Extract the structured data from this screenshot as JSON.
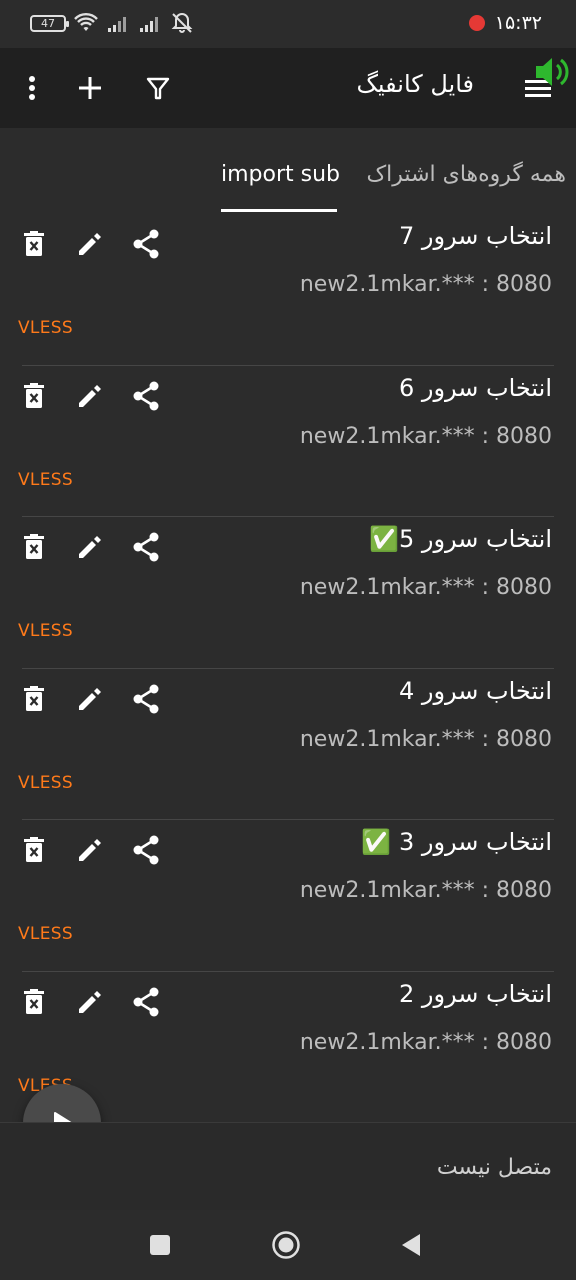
{
  "status_bar": {
    "battery": "47",
    "time": "۱۵:۳۲",
    "icons": [
      "battery-icon",
      "wifi-icon",
      "signal-icon",
      "signal-icon",
      "mute-icon",
      "recording-icon"
    ]
  },
  "toolbar": {
    "title": "فایل کانفیگ",
    "icons": [
      "menu-icon",
      "filter-icon",
      "add-icon",
      "more-vert-icon",
      "speaker-icon"
    ]
  },
  "tabs": [
    {
      "label": "import sub",
      "active": true
    },
    {
      "label": "همه گروه‌های اشتراک",
      "active": false
    }
  ],
  "servers": [
    {
      "name": "انتخاب سرور 7",
      "address": "new2.1mkar.*** : 8080",
      "protocol": "VLESS"
    },
    {
      "name": "انتخاب سرور 6",
      "address": "new2.1mkar.*** : 8080",
      "protocol": "VLESS"
    },
    {
      "name": "انتخاب سرور 5✅",
      "address": "new2.1mkar.*** : 8080",
      "protocol": "VLESS"
    },
    {
      "name": "انتخاب سرور 4",
      "address": "new2.1mkar.*** : 8080",
      "protocol": "VLESS"
    },
    {
      "name": "انتخاب سرور 3 ✅",
      "address": "new2.1mkar.*** : 8080",
      "protocol": "VLESS"
    },
    {
      "name": "انتخاب سرور 2",
      "address": "new2.1mkar.*** : 8080",
      "protocol": "VLESS"
    }
  ],
  "bottom": {
    "status": "متصل نیست"
  },
  "colors": {
    "accent": "#ff7a1a",
    "background": "#2c2c2c",
    "toolbar": "#202020",
    "check": "#4caf50"
  }
}
